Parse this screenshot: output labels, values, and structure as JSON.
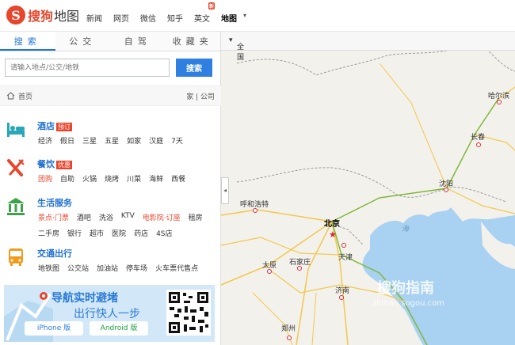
{
  "header": {
    "logo_mark": "S",
    "brand": "搜狗",
    "brand_suffix": "地图",
    "nav": [
      "新闻",
      "网页",
      "微信",
      "知乎",
      "英文",
      "地图"
    ],
    "new_badge": "新",
    "active_nav": "地图"
  },
  "sidebar": {
    "tabs": [
      "搜索",
      "公交",
      "自驾",
      "收藏夹"
    ],
    "search_placeholder": "请输入地点/公交/地铁",
    "search_button": "搜索",
    "breadcrumb_home": "首页",
    "shortcuts": "家 | 公司",
    "categories": [
      {
        "title": "酒店",
        "tag": "预订",
        "links": [
          "经济",
          "假日",
          "三星",
          "五星",
          "如家",
          "汉庭",
          "7天"
        ]
      },
      {
        "title": "餐饮",
        "tag": "优惠",
        "links": [
          "团购",
          "自助",
          "火锅",
          "烧烤",
          "川菜",
          "海鲜",
          "西餐"
        ]
      },
      {
        "title": "生活服务",
        "tag": "",
        "links": [
          "景点·门票",
          "酒吧",
          "洗浴",
          "KTV",
          "电影院·订座",
          "租房",
          "二手房",
          "银行",
          "超市",
          "医院",
          "药店",
          "4S店"
        ]
      },
      {
        "title": "交通出行",
        "tag": "",
        "links": [
          "地铁图",
          "公交站",
          "加油站",
          "停车场",
          "火车票代售点"
        ]
      }
    ]
  },
  "banner": {
    "headline": "导航实时避堵",
    "subline": "出行快人一步",
    "iphone_button": "iPhone 版",
    "android_button": "Android 版"
  },
  "map": {
    "scope_selector": "全国",
    "cities": [
      {
        "name": "哈尔滨"
      },
      {
        "name": "长春"
      },
      {
        "name": "沈阳"
      },
      {
        "name": "呼和浩特"
      },
      {
        "name": "北京"
      },
      {
        "name": "天津"
      },
      {
        "name": "太原"
      },
      {
        "name": "石家庄"
      },
      {
        "name": "济南"
      },
      {
        "name": "郑州"
      }
    ],
    "sea_label": "海",
    "watermark_main": "搜狗指南",
    "watermark_url": "zhinan.sogou.com",
    "colors": {
      "land": "#f3f1ec",
      "water": "#a9d1f1",
      "road": "#f2c84b",
      "highway": "#7fb83a"
    }
  }
}
